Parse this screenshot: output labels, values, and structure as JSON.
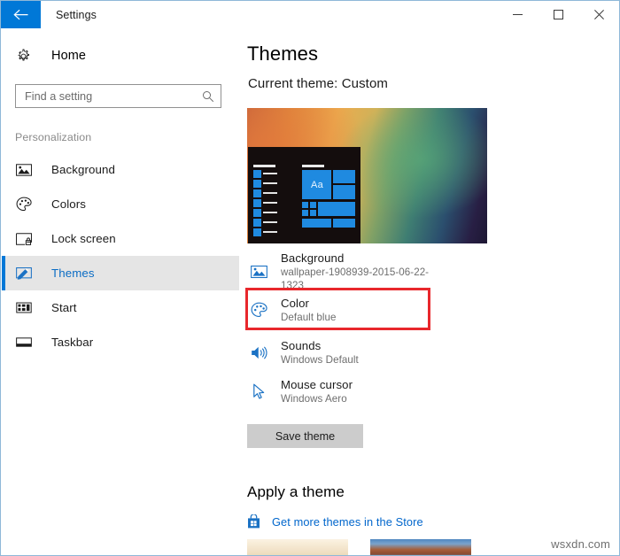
{
  "window": {
    "title": "Settings",
    "back_icon": "back-arrow-icon",
    "minimize_label": "─",
    "maximize_label": "□",
    "close_label": "✕"
  },
  "sidebar": {
    "home_label": "Home",
    "home_icon": "gear-icon",
    "search": {
      "placeholder": "Find a setting",
      "value": "",
      "icon": "search-icon"
    },
    "section_label": "Personalization",
    "items": [
      {
        "label": "Background",
        "icon": "picture-icon",
        "selected": false
      },
      {
        "label": "Colors",
        "icon": "palette-icon",
        "selected": false
      },
      {
        "label": "Lock screen",
        "icon": "lock-screen-icon",
        "selected": false
      },
      {
        "label": "Themes",
        "icon": "themes-brush-icon",
        "selected": true
      },
      {
        "label": "Start",
        "icon": "start-tiles-icon",
        "selected": false
      },
      {
        "label": "Taskbar",
        "icon": "taskbar-icon",
        "selected": false
      }
    ]
  },
  "main": {
    "page_title": "Themes",
    "current_theme": "Current theme: Custom",
    "preview": {
      "name": "theme-preview",
      "start_menu_tile_text": "Aa"
    },
    "settings_rows": [
      {
        "name": "background",
        "title": "Background",
        "subtitle": "wallpaper-1908939-2015-06-22-1323",
        "icon": "picture-icon",
        "highlighted": false
      },
      {
        "name": "color",
        "title": "Color",
        "subtitle": "Default blue",
        "icon": "palette-icon",
        "highlighted": true
      },
      {
        "name": "sounds",
        "title": "Sounds",
        "subtitle": "Windows Default",
        "icon": "speaker-icon",
        "highlighted": false
      },
      {
        "name": "mouse-cursor",
        "title": "Mouse cursor",
        "subtitle": "Windows Aero",
        "icon": "cursor-icon",
        "highlighted": false
      }
    ],
    "save_theme_label": "Save theme",
    "apply_theme_title": "Apply a theme",
    "store_link_label": "Get more themes in the Store",
    "store_icon": "store-bag-icon",
    "thumbnails": [
      {
        "name": "theme-thumbnail-1"
      },
      {
        "name": "theme-thumbnail-2"
      }
    ]
  },
  "colors": {
    "accent": "#0078d7",
    "highlight_box": "#e8272c",
    "link": "#0066cc",
    "selected_row_bg": "#e5e5e5"
  },
  "watermark": "wsxdn.com"
}
